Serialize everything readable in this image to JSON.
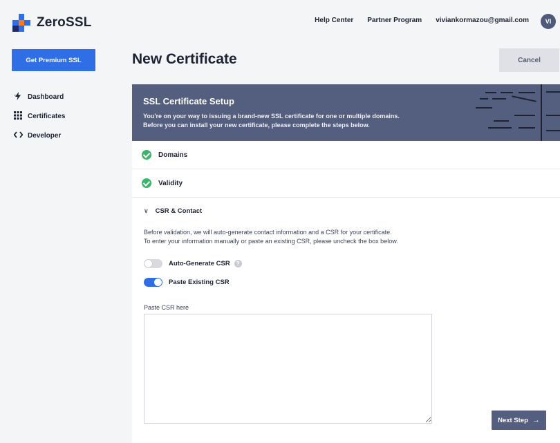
{
  "app": {
    "name": "ZeroSSL"
  },
  "top_nav": {
    "help_center": "Help Center",
    "partner_program": "Partner Program",
    "email": "viviankormazou@gmail.com",
    "avatar_initials": "VI"
  },
  "sidebar": {
    "premium_button": "Get Premium SSL",
    "items": [
      {
        "label": "Dashboard",
        "icon": "lightning-icon"
      },
      {
        "label": "Certificates",
        "icon": "grid-dots-icon"
      },
      {
        "label": "Developer",
        "icon": "code-brackets-icon"
      }
    ]
  },
  "page": {
    "title": "New Certificate",
    "cancel_label": "Cancel"
  },
  "setup": {
    "title": "SSL Certificate Setup",
    "subtitle_line1": "You're on your way to issuing a brand-new SSL certificate for one or multiple domains.",
    "subtitle_line2": "Before you can install your new certificate, please complete the steps below.",
    "steps": [
      {
        "label": "Domains",
        "status": "complete"
      },
      {
        "label": "Validity",
        "status": "complete"
      }
    ],
    "csr": {
      "title": "CSR & Contact",
      "desc_line1": "Before validation, we will auto-generate contact information and a CSR for your certificate.",
      "desc_line2": "To enter your information manually or paste an existing CSR, please uncheck the box below.",
      "auto_generate_label": "Auto-Generate CSR",
      "auto_generate_on": false,
      "paste_existing_label": "Paste Existing CSR",
      "paste_existing_on": true,
      "paste_label": "Paste CSR here",
      "paste_value": ""
    },
    "next_label": "Next Step"
  },
  "colors": {
    "brand_blue": "#2f6ee5",
    "panel_header": "#545e7e",
    "success_green": "#3db36b"
  }
}
